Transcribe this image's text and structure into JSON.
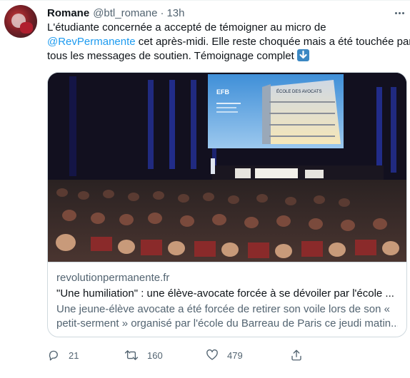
{
  "tweet": {
    "author_name": "Romane",
    "handle": "@btl_romane",
    "separator": "·",
    "time": "13h",
    "text_lines": {
      "l1": "L'étudiante concernée a accepté de témoigner au micro de",
      "l2_mention": "@RevPermanente",
      "l2_rest": " cet après-midi. Elle reste choquée mais a été touchée par",
      "l3": "tous les messages de soutien. Témoignage complet"
    },
    "emoji_icon": "down-arrow-emoji"
  },
  "card": {
    "domain": "revolutionpermanente.fr",
    "title": "\"Une humiliation\" : une élève-avocate forcée à se dévoiler par l'école ...",
    "description_line1": "Une jeune-élève avocate a été forcée de retirer son voile lors de son «",
    "description_line2": "petit-serment » organisé par l'école du Barreau de Paris ce jeudi matin...",
    "screen_text": {
      "building_sign": "ÉCOLE DES AVOCATS",
      "logo": "EFB"
    }
  },
  "actions": {
    "reply_count": "21",
    "retweet_count": "160",
    "like_count": "479"
  },
  "colors": {
    "text": "#0f1419",
    "secondary": "#536471",
    "accent": "#1d9bf0",
    "border": "#cfd9de"
  }
}
